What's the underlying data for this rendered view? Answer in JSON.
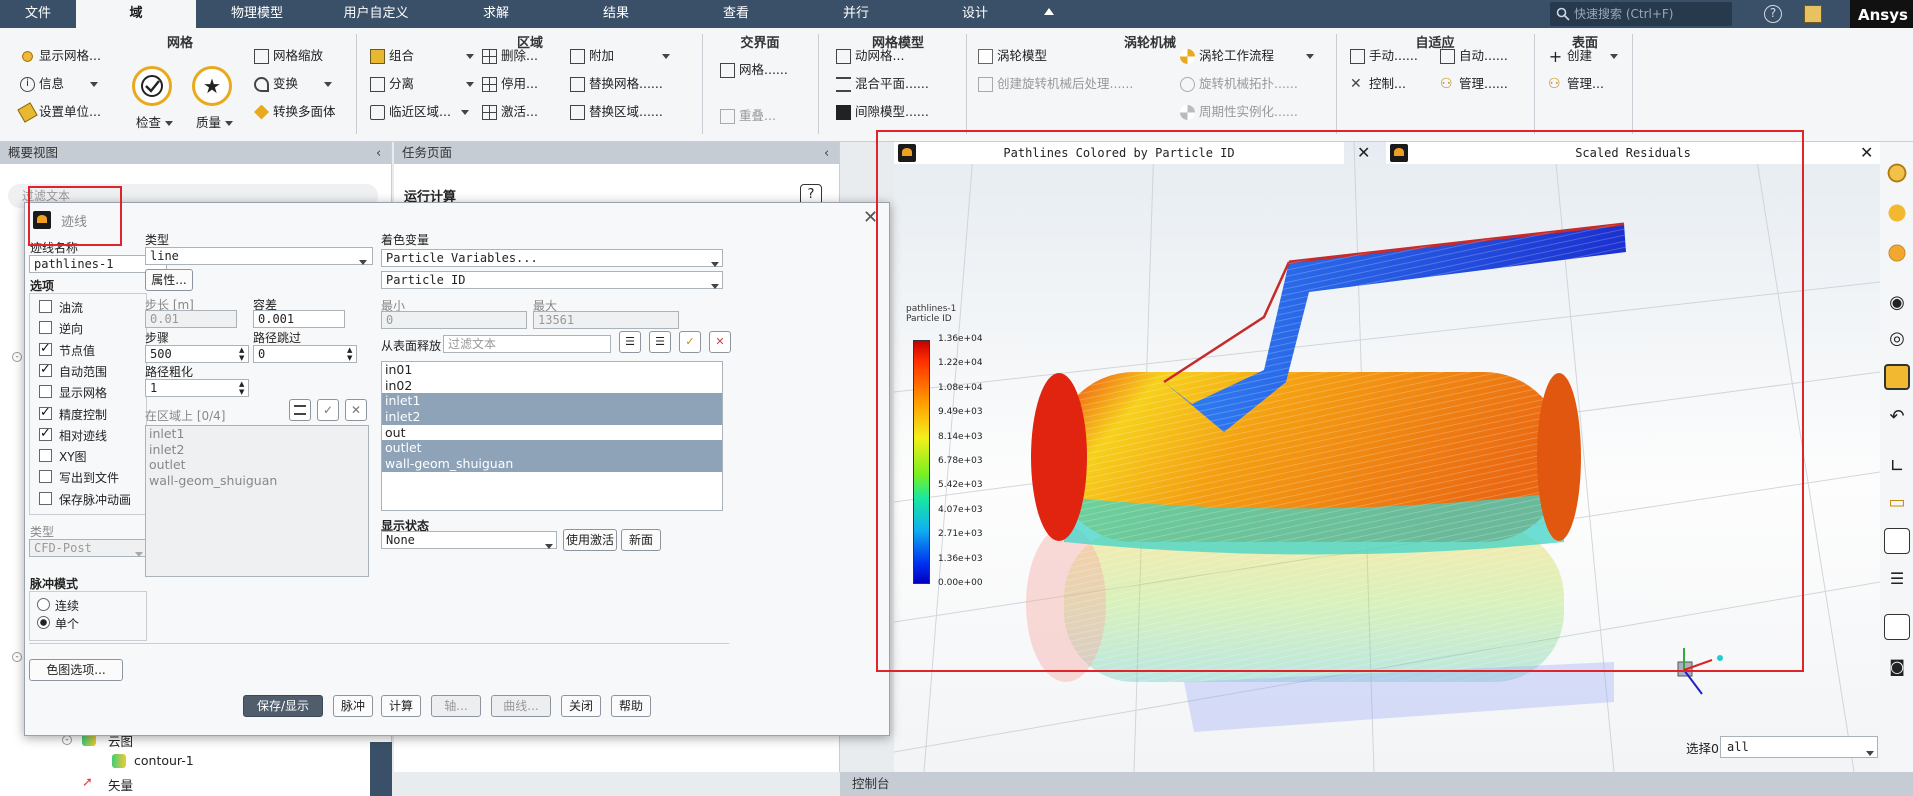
{
  "menu": {
    "items": [
      "文件",
      "域",
      "物理模型",
      "用户自定义",
      "求解",
      "结果",
      "查看",
      "并行",
      "设计"
    ],
    "active": 1,
    "search_placeholder": "快速搜索 (Ctrl+F)",
    "brand": "Ansys"
  },
  "ribbon": {
    "groups": [
      "网格",
      "区域",
      "交界面",
      "网格模型",
      "涡轮机械",
      "自适应",
      "表面"
    ],
    "mesh": {
      "display": "显示网格...",
      "info": "信息",
      "units": "设置单位...",
      "check": "检查",
      "quality": "质量",
      "scale": "网格缩放",
      "transform": "变换",
      "polyhedra": "转换多面体"
    },
    "zones": {
      "combine": "组合",
      "separate": "分离",
      "adjacency": "临近区域...",
      "delete": "删除...",
      "deactivate": "停用...",
      "activate": "激活...",
      "append": "附加",
      "replace_mesh": "替换网格......",
      "replace_zone": "替换区域......"
    },
    "interface": {
      "mesh": "网格......",
      "overlap": "重叠..."
    },
    "mesh_models": {
      "dynamic": "动网格...",
      "mixing": "混合平面......",
      "gap": "间隙模型......"
    },
    "turbo": {
      "model": "涡轮模型",
      "workflow": "涡轮工作流程",
      "post": "创建旋转机械后处理......",
      "topology": "旋转机械拓扑......",
      "periodic": "周期性实例化......"
    },
    "adapt": {
      "manual": "手动......",
      "auto": "自动......",
      "control": "控制...",
      "manage": "管理......"
    },
    "surface": {
      "create": "创建",
      "manage": "管理..."
    }
  },
  "outline": {
    "title": "概要视图",
    "filter_placeholder": "过滤文本",
    "tree": {
      "contours": "云图",
      "contour1": "contour-1",
      "vectors": "矢量"
    }
  },
  "task": {
    "title": "任务页面",
    "run": "运行计算"
  },
  "console": {
    "title": "控制台"
  },
  "dialog": {
    "title": "迹线",
    "name_label": "迹线名称",
    "name_value": "pathlines-1",
    "options_label": "选项",
    "options": [
      {
        "label": "油流",
        "checked": false
      },
      {
        "label": "逆向",
        "checked": false
      },
      {
        "label": "节点值",
        "checked": true
      },
      {
        "label": "自动范围",
        "checked": true
      },
      {
        "label": "显示网格",
        "checked": false
      },
      {
        "label": "精度控制",
        "checked": true
      },
      {
        "label": "相对迹线",
        "checked": true
      },
      {
        "label": "XY图",
        "checked": false
      },
      {
        "label": "写出到文件",
        "checked": false
      },
      {
        "label": "保存脉冲动画",
        "checked": false
      }
    ],
    "type_label": "类型",
    "type_value": "CFD-Post",
    "pulse_label": "脉冲模式",
    "pulse_continuous": "连续",
    "pulse_single": "单个",
    "colormap_btn": "色图选项...",
    "style_label": "类型",
    "style_value": "line",
    "attributes_btn": "属性...",
    "step_size_label": "步长 [m]",
    "step_size_value": "0.01",
    "tolerance_label": "容差",
    "tolerance_value": "0.001",
    "steps_label": "步骤",
    "steps_value": "500",
    "path_skip_label": "路径跳过",
    "path_skip_value": "0",
    "coarsen_label": "路径粗化",
    "coarsen_value": "1",
    "on_zone_label": "在区域上 [0/4]",
    "on_zone_items": [
      "inlet1",
      "inlet2",
      "outlet",
      "wall-geom_shuiguan"
    ],
    "color_by_label": "着色变量",
    "color_by_1": "Particle Variables...",
    "color_by_2": "Particle ID",
    "min_label": "最小",
    "min_value": "0",
    "max_label": "最大",
    "max_value": "13561",
    "release_label": "从表面释放",
    "release_filter_placeholder": "过滤文本",
    "release_items": [
      {
        "name": "in01",
        "selected": false
      },
      {
        "name": "in02",
        "selected": false
      },
      {
        "name": "inlet1",
        "selected": true
      },
      {
        "name": "inlet2",
        "selected": true
      },
      {
        "name": "out",
        "selected": false
      },
      {
        "name": "outlet",
        "selected": true
      },
      {
        "name": "wall-geom_shuiguan",
        "selected": true
      }
    ],
    "display_state_label": "显示状态",
    "display_state_value": "None",
    "use_active_btn": "使用激活",
    "new_btn": "新面",
    "footer": {
      "save": "保存/显示",
      "pulse": "脉冲",
      "compute": "计算",
      "axis": "轴...",
      "curve": "曲线...",
      "close": "关闭",
      "help": "帮助"
    }
  },
  "graphics": {
    "window1_title": "Pathlines Colored by Particle ID",
    "window2_title": "Scaled Residuals",
    "legend_title1": "pathlines-1",
    "legend_title2": "Particle ID",
    "legend_ticks": [
      "1.36e+04",
      "1.22e+04",
      "1.08e+04",
      "9.49e+03",
      "8.14e+03",
      "6.78e+03",
      "5.42e+03",
      "4.07e+03",
      "2.71e+03",
      "1.36e+03",
      "0.00e+00"
    ],
    "select_label": "选择0",
    "select_value": "all"
  },
  "colors": {
    "menubar": "#3a5068",
    "accent_selection": "#8ea2b8",
    "annotation": "#e0242c"
  }
}
